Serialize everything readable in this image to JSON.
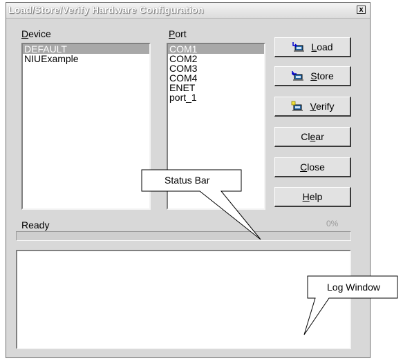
{
  "window": {
    "title": "Load/Store/Verify Hardware Configuration",
    "close_label": "x"
  },
  "device": {
    "label_prefix": "",
    "label_mnemonic": "D",
    "label_rest": "evice",
    "items": [
      "DEFAULT",
      "NIUExample"
    ],
    "selected": "DEFAULT"
  },
  "port": {
    "label_mnemonic": "P",
    "label_rest": "ort",
    "items": [
      "COM1",
      "COM2",
      "COM3",
      "COM4",
      "ENET",
      "port_1"
    ],
    "selected": "COM1"
  },
  "buttons": {
    "load": {
      "mnemonic": "L",
      "rest": "oad",
      "icon": "load-icon"
    },
    "store": {
      "mnemonic": "S",
      "rest": "tore",
      "icon": "store-icon"
    },
    "verify": {
      "mnemonic": "V",
      "rest": "erify",
      "icon": "verify-icon"
    },
    "clear": {
      "pre": "Cl",
      "mnemonic": "e",
      "rest": "ar"
    },
    "close": {
      "mnemonic": "C",
      "rest": "lose"
    },
    "help": {
      "mnemonic": "H",
      "rest": "elp"
    }
  },
  "status": {
    "text": "Ready",
    "progress_label": "0%",
    "progress_fraction": 0
  },
  "callouts": {
    "status_bar": "Status Bar",
    "log_window": "Log Window"
  }
}
